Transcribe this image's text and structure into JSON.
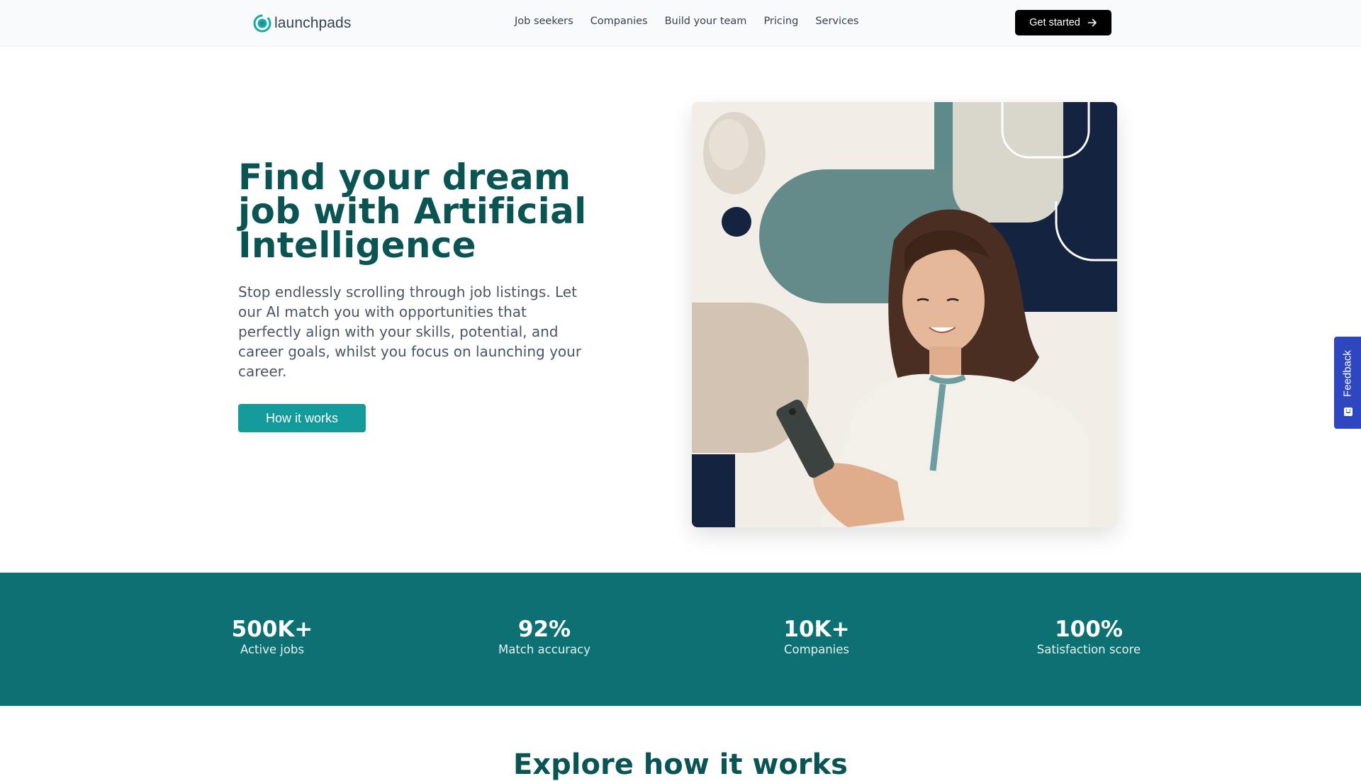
{
  "nav": {
    "brand": "launchpads",
    "links": [
      "Job seekers",
      "Companies",
      "Build your team",
      "Pricing",
      "Services"
    ],
    "cta_label": "Get started"
  },
  "hero": {
    "title": "Find your dream job with Artificial Intelligence",
    "subtitle": "Stop endlessly scrolling through job listings. Let our AI match you with opportunities that perfectly align with your skills, potential, and career goals, whilst you focus on launching your career.",
    "button_label": "How it works",
    "image_alt": "Smiling young woman looking at her smartphone in front of abstract geometric shapes"
  },
  "stats": [
    {
      "value": "500K+",
      "label": "Active jobs"
    },
    {
      "value": "92%",
      "label": "Match accuracy"
    },
    {
      "value": "10K+",
      "label": "Companies"
    },
    {
      "value": "100%",
      "label": "Satisfaction score"
    }
  ],
  "section": {
    "heading": "Explore how it works"
  },
  "feedback": {
    "label": "Feedback"
  },
  "colors": {
    "brand_teal": "#139a9a",
    "heading_teal": "#0b5454",
    "stats_bg": "#0d7073",
    "feedback_blue": "#2e46c0"
  }
}
